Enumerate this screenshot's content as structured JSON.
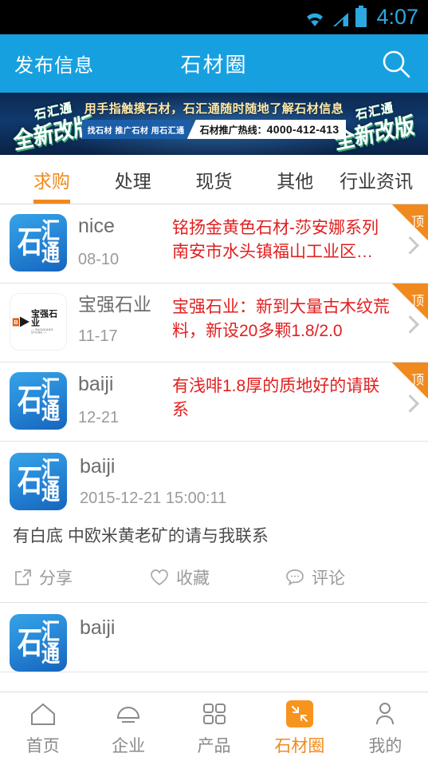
{
  "status_bar": {
    "time": "4:07",
    "wifi_icon": "wifi-icon",
    "signal_icon": "signal-icon",
    "battery_icon": "battery-icon"
  },
  "header": {
    "left_action": "发布信息",
    "title": "石材圈",
    "search_icon": "search-icon"
  },
  "banner": {
    "side_line1": "石汇通",
    "side_line2": "全新改版",
    "headline": "用手指触摸石材，石汇通随时随地了解石材信息",
    "tag": "找石材 推广石材 用石汇通",
    "hotline_label": "石材推广热线：",
    "hotline_number": "4000-412-413"
  },
  "tabs": [
    {
      "label": "求购",
      "active": true
    },
    {
      "label": "处理",
      "active": false
    },
    {
      "label": "现货",
      "active": false
    },
    {
      "label": "其他",
      "active": false
    },
    {
      "label": "行业资讯",
      "active": false
    }
  ],
  "promoted": [
    {
      "avatar_type": "shihuitong",
      "avatar_text": "石汇通",
      "user": "nice",
      "date": "08-10",
      "text": "铭扬金黄色石材-莎安娜系列南安市水头镇福山工业区…",
      "badge": "顶"
    },
    {
      "avatar_type": "baoqiang",
      "avatar_text": "宝强石业",
      "avatar_subtext": "— BAOQIANG STONE —",
      "avatar_mark": "B",
      "user": "宝强石业",
      "date": "11-17",
      "text": "宝强石业：新到大量古木纹荒料，新设20多颗1.8/2.0",
      "badge": "顶"
    },
    {
      "avatar_type": "shihuitong",
      "avatar_text": "石汇通",
      "user": "baiji",
      "date": "12-21",
      "text": "有浅啡1.8厚的质地好的请联系",
      "badge": "顶"
    }
  ],
  "posts": [
    {
      "avatar_text": "石汇通",
      "user": "baiji",
      "time": "2015-12-21 15:00:11",
      "body": "有白底 中欧米黄老矿的请与我联系",
      "actions": [
        {
          "label": "分享",
          "icon": "share-icon"
        },
        {
          "label": "收藏",
          "icon": "heart-icon"
        },
        {
          "label": "评论",
          "icon": "comment-icon"
        }
      ]
    },
    {
      "avatar_text": "石汇通",
      "user": "baiji",
      "time": "",
      "body": "",
      "actions": []
    }
  ],
  "bottom_nav": [
    {
      "label": "首页",
      "icon": "home-icon",
      "active": false
    },
    {
      "label": "企业",
      "icon": "company-icon",
      "active": false
    },
    {
      "label": "产品",
      "icon": "grid-icon",
      "active": false
    },
    {
      "label": "石材圈",
      "icon": "stone-circle-icon",
      "active": true
    },
    {
      "label": "我的",
      "icon": "person-icon",
      "active": false
    }
  ],
  "colors": {
    "header_blue": "#17a0e0",
    "accent_orange": "#f08a1c",
    "promo_red": "#e21f1f",
    "status_cyan": "#29a9e1",
    "banner_navy": "#10396c"
  }
}
